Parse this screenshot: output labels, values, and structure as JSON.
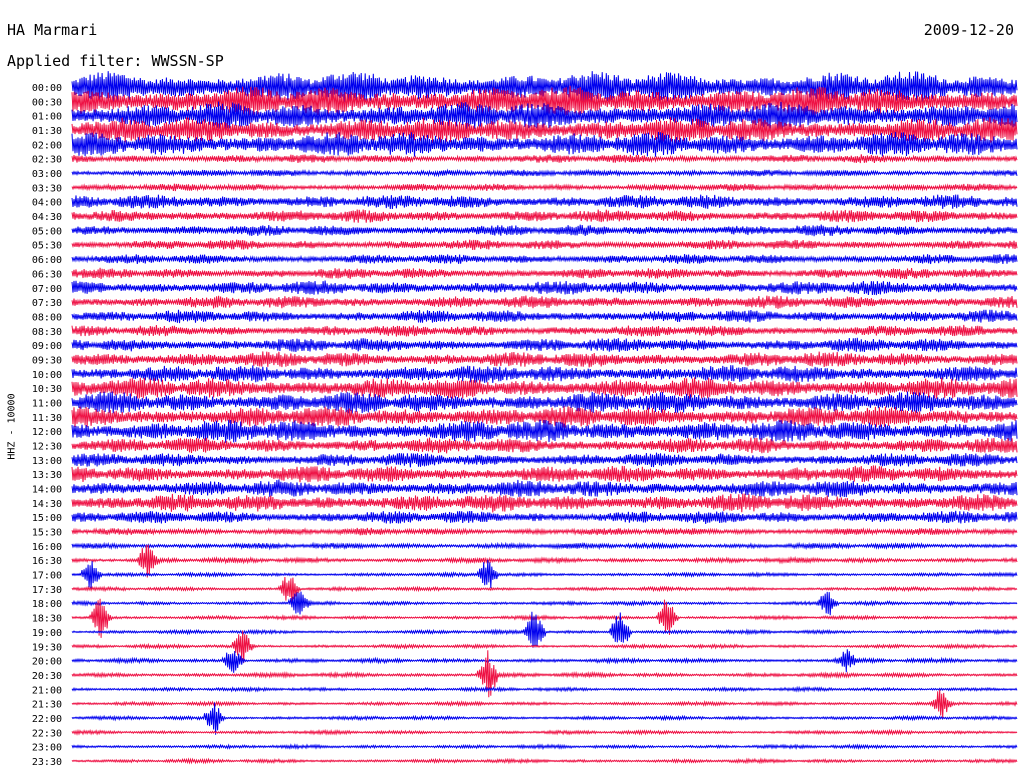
{
  "header": {
    "station": "HA Marmari",
    "filter": "Applied filter: WWSSN-SP",
    "date": "2009-12-20"
  },
  "chart_data": {
    "type": "line",
    "title": "HA Marmari",
    "subtitle": "Applied filter: WWSSN-SP",
    "ylabel": "HHZ - 10000",
    "date": "2009-12-20",
    "row_times": [
      "00:00",
      "00:30",
      "01:00",
      "01:30",
      "02:00",
      "02:30",
      "03:00",
      "03:30",
      "04:00",
      "04:30",
      "05:00",
      "05:30",
      "06:00",
      "06:30",
      "07:00",
      "07:30",
      "08:00",
      "08:30",
      "09:00",
      "09:30",
      "10:00",
      "10:30",
      "11:00",
      "11:30",
      "12:00",
      "12:30",
      "13:00",
      "13:30",
      "14:00",
      "14:30",
      "15:00",
      "15:30",
      "16:00",
      "16:30",
      "17:00",
      "17:30",
      "18:00",
      "18:30",
      "19:00",
      "19:30",
      "20:00",
      "20:30",
      "21:00",
      "21:30",
      "22:00",
      "22:30",
      "23:00",
      "23:30"
    ],
    "colors": [
      "#0000ee",
      "#ee1144"
    ],
    "row_amplitude": [
      0.45,
      0.42,
      0.38,
      0.36,
      0.35,
      0.12,
      0.09,
      0.1,
      0.2,
      0.18,
      0.16,
      0.14,
      0.14,
      0.15,
      0.2,
      0.18,
      0.18,
      0.16,
      0.2,
      0.22,
      0.25,
      0.3,
      0.3,
      0.3,
      0.32,
      0.22,
      0.2,
      0.24,
      0.24,
      0.26,
      0.18,
      0.1,
      0.08,
      0.07,
      0.05,
      0.05,
      0.05,
      0.05,
      0.05,
      0.05,
      0.06,
      0.06,
      0.05,
      0.05,
      0.05,
      0.05,
      0.05,
      0.05
    ],
    "events": [
      {
        "time": "16:30",
        "x_frac": 0.08,
        "amp": 0.6
      },
      {
        "time": "17:00",
        "x_frac": 0.02,
        "amp": 0.5
      },
      {
        "time": "17:00",
        "x_frac": 0.44,
        "amp": 0.5
      },
      {
        "time": "17:30",
        "x_frac": 0.23,
        "amp": 0.5
      },
      {
        "time": "18:00",
        "x_frac": 0.24,
        "amp": 0.4
      },
      {
        "time": "18:00",
        "x_frac": 0.8,
        "amp": 0.4
      },
      {
        "time": "18:30",
        "x_frac": 0.03,
        "amp": 0.6
      },
      {
        "time": "18:30",
        "x_frac": 0.63,
        "amp": 0.6
      },
      {
        "time": "19:00",
        "x_frac": 0.49,
        "amp": 0.7
      },
      {
        "time": "19:00",
        "x_frac": 0.58,
        "amp": 0.6
      },
      {
        "time": "19:30",
        "x_frac": 0.18,
        "amp": 0.5
      },
      {
        "time": "20:00",
        "x_frac": 0.17,
        "amp": 0.4
      },
      {
        "time": "20:00",
        "x_frac": 0.82,
        "amp": 0.3
      },
      {
        "time": "20:30",
        "x_frac": 0.44,
        "amp": 0.7
      },
      {
        "time": "21:30",
        "x_frac": 0.92,
        "amp": 0.4
      },
      {
        "time": "22:00",
        "x_frac": 0.15,
        "amp": 0.5
      }
    ]
  }
}
